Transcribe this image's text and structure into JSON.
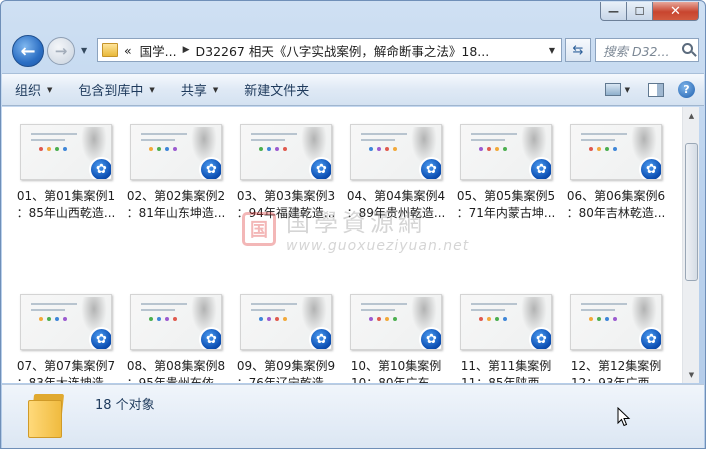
{
  "window": {
    "caption_buttons": {
      "minimize": "—",
      "maximize": "☐",
      "close": "✕"
    }
  },
  "nav": {
    "back_glyph": "←",
    "forward_glyph": "→",
    "breadcrumbs": [
      "«",
      "国学...",
      "D32267 相天《八字实战案例，解命断事之法》18..."
    ],
    "search_placeholder": "搜索 D32..."
  },
  "toolbar": {
    "organize": "组织",
    "include_in_library": "包含到库中",
    "share": "共享",
    "new_folder": "新建文件夹",
    "help": "?"
  },
  "watermark": {
    "seal": "国",
    "title": "国學資源網",
    "url": "www.guoxueziyuan.net"
  },
  "files": [
    {
      "line1": "01、第01集案例1",
      "line2": "：85年山西乾造..."
    },
    {
      "line1": "02、第02集案例2",
      "line2": "：81年山东坤造..."
    },
    {
      "line1": "03、第03集案例3",
      "line2": "：94年福建乾造..."
    },
    {
      "line1": "04、第04集案例4",
      "line2": "：89年贵州乾造..."
    },
    {
      "line1": "05、第05集案例5",
      "line2": "：71年内蒙古坤..."
    },
    {
      "line1": "06、第06集案例6",
      "line2": "：80年吉林乾造..."
    },
    {
      "line1": "07、第07集案例7",
      "line2": "：83年大连坤造..."
    },
    {
      "line1": "08、第08集案例8",
      "line2": "：95年贵州布依..."
    },
    {
      "line1": "09、第09集案例9",
      "line2": "：76年辽宁乾造..."
    },
    {
      "line1": "10、第10集案例",
      "line2": "10：80年广东..."
    },
    {
      "line1": "11、第11集案例",
      "line2": "11：85年陕西..."
    },
    {
      "line1": "12、第12集案例",
      "line2": "12：93年广西..."
    }
  ],
  "status": {
    "count": "18 个对象"
  },
  "colors": {
    "accent": "#1e56a6",
    "badge": "#0c4fb3",
    "folder": "#f0bb3f"
  }
}
